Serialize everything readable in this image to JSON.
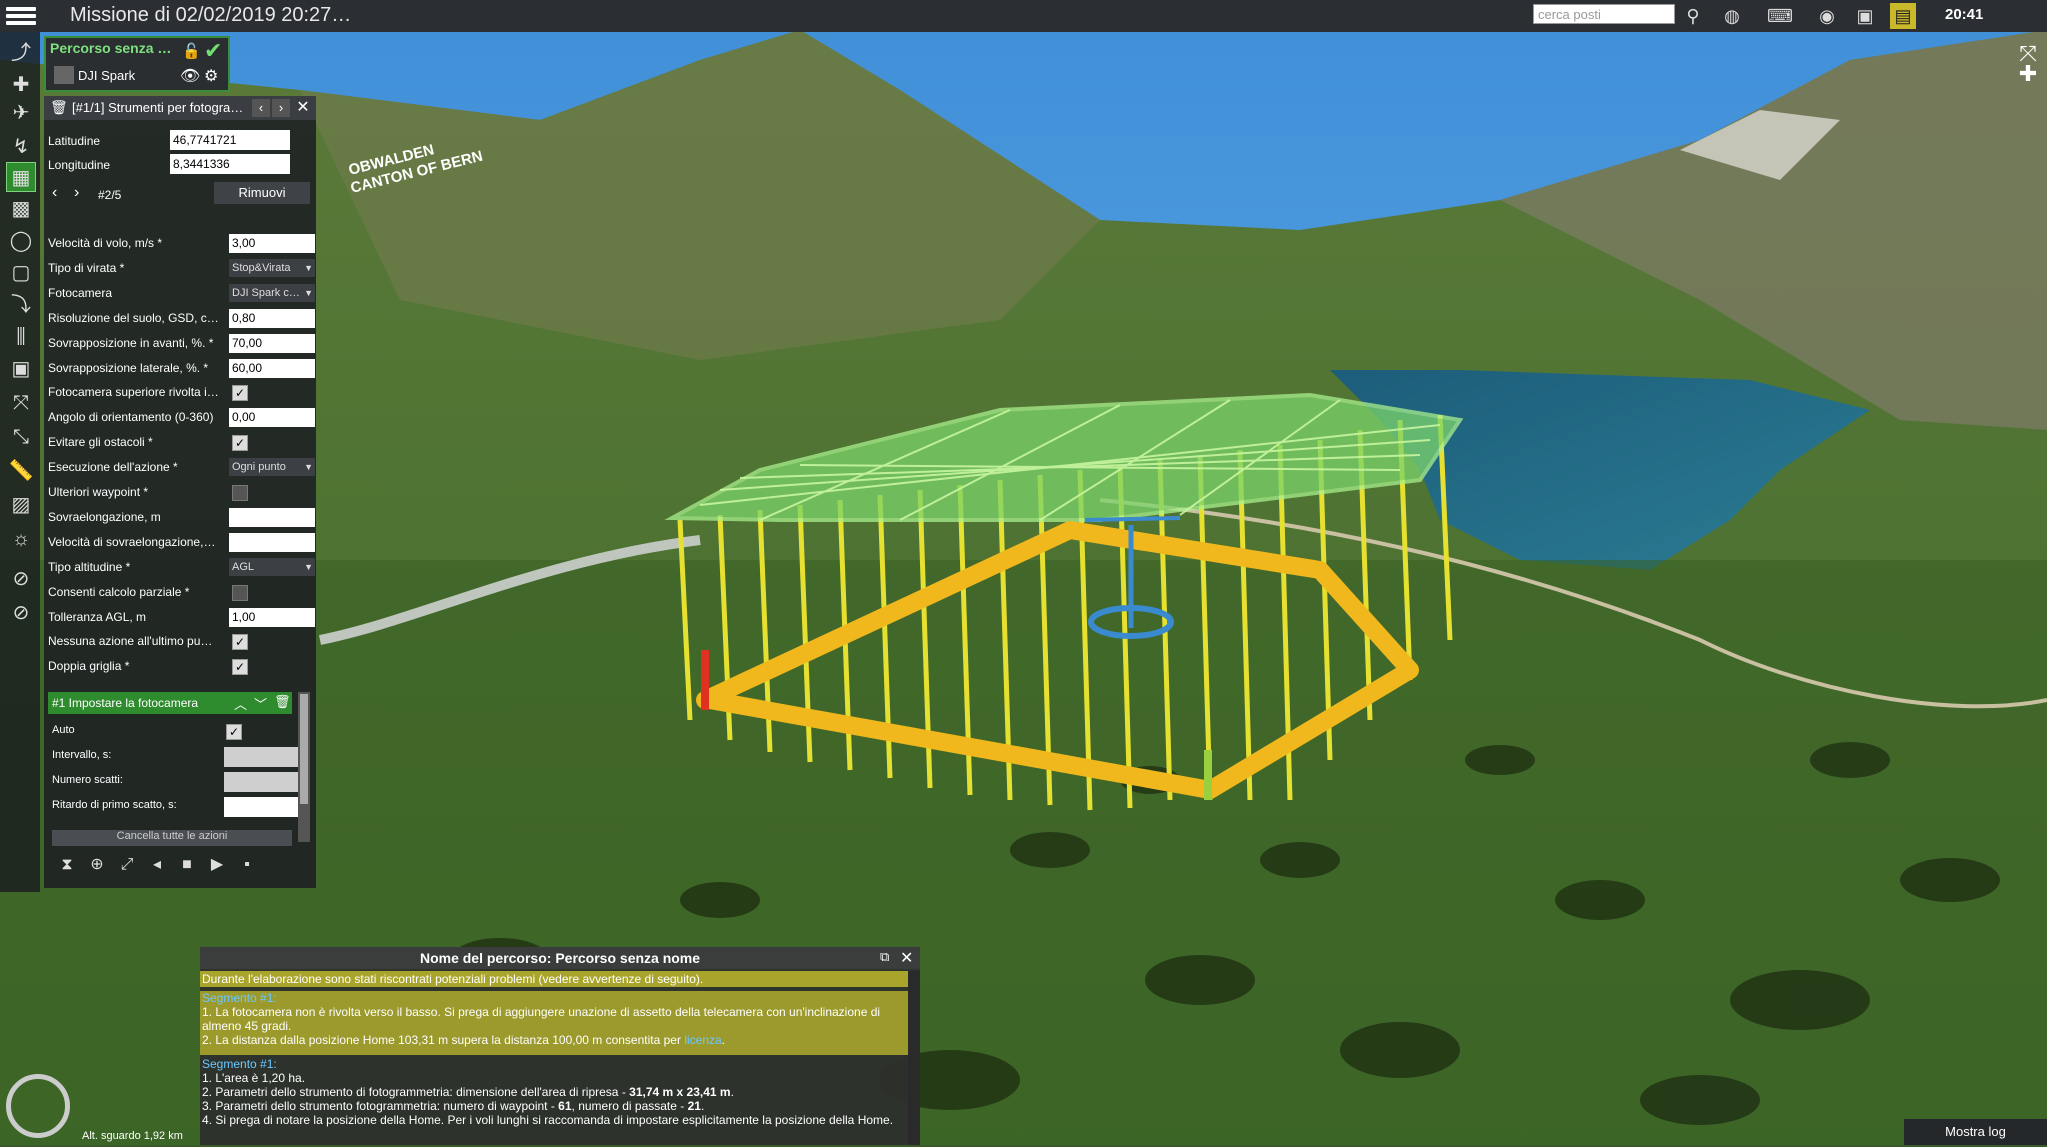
{
  "window": {
    "title": "Missione di 02/02/2019 20:27…",
    "clock": "20:41"
  },
  "search": {
    "placeholder": "cerca posti"
  },
  "route": {
    "name": "Percorso senza …",
    "drone": "DJI Spark"
  },
  "tool_panel": {
    "title": "[#1/1] Strumenti per fotogra…",
    "latitude_label": "Latitudine",
    "latitude_value": "46,7741721",
    "longitude_label": "Longitudine",
    "longitude_value": "8,3441336",
    "point_index": "#2/5",
    "remove_label": "Rimuovi",
    "params": [
      {
        "label": "Velocità di volo, m/s *",
        "type": "field",
        "value": "3,00"
      },
      {
        "label": "Tipo di virata *",
        "type": "select",
        "value": "Stop&Virata"
      },
      {
        "label": "Fotocamera",
        "type": "select",
        "value": "DJI Spark c…"
      },
      {
        "label": "Risoluzione del suolo, GSD, c…",
        "type": "field",
        "value": "0,80"
      },
      {
        "label": "Sovrapposizione in avanti, %. *",
        "type": "field",
        "value": "70,00"
      },
      {
        "label": "Sovrapposizione laterale, %. *",
        "type": "field",
        "value": "60,00"
      },
      {
        "label": "Fotocamera superiore rivolta i…",
        "type": "check",
        "value": "true"
      },
      {
        "label": "Angolo di orientamento (0-360)",
        "type": "field",
        "value": "0,00"
      },
      {
        "label": "Evitare gli ostacoli *",
        "type": "check",
        "value": "true"
      },
      {
        "label": "Esecuzione dell'azione *",
        "type": "select",
        "value": "Ogni punto"
      },
      {
        "label": "Ulteriori waypoint *",
        "type": "check",
        "value": "false"
      },
      {
        "label": "Sovraelongazione, m",
        "type": "field",
        "value": ""
      },
      {
        "label": "Velocità di sovraelongazione,…",
        "type": "field",
        "value": ""
      },
      {
        "label": "Tipo altitudine *",
        "type": "select",
        "value": "AGL"
      },
      {
        "label": "Consenti calcolo parziale *",
        "type": "check",
        "value": "false"
      },
      {
        "label": "Tolleranza AGL, m",
        "type": "field",
        "value": "1,00"
      },
      {
        "label": "Nessuna azione all'ultimo pu…",
        "type": "check",
        "value": "true"
      },
      {
        "label": "Doppia griglia *",
        "type": "check",
        "value": "true"
      }
    ]
  },
  "action": {
    "title": "#1 Impostare la fotocamera",
    "rows": [
      {
        "label": "Auto",
        "type": "check"
      },
      {
        "label": "Intervallo, s:",
        "type": "gray"
      },
      {
        "label": "Numero scatti:",
        "type": "gray"
      },
      {
        "label": "Ritardo di primo scatto, s:",
        "type": "white"
      }
    ],
    "cancel_label": "Cancella tutte le azioni"
  },
  "messages": {
    "title": "Nome del percorso: Percorso senza nome",
    "warning": "Durante l'elaborazione sono stati riscontrati potenziali problemi (vedere avvertenze di seguito).",
    "segment1_title": "Segmento #1:",
    "segment1_line1": "1. La fotocamera non è rivolta verso il basso. Si prega di aggiungere unazione di assetto della telecamera con un'inclinazione di almeno 45 gradi.",
    "segment1_line2": "2. La distanza dalla posizione Home 103,31 m supera la distanza 100,00 m consentita per",
    "segment1_link": "licenza",
    "segment2_title": "Segmento #1:",
    "segment2_line1": "1. L'area è 1,20 ha.",
    "segment2_line2_a": "2. Parametri dello strumento di fotogrammetria: dimensione dell'area di ripresa -",
    "segment2_line2_b": "31,74 m x 23,41 m",
    "segment2_line3_a": "3. Parametri dello strumento fotogrammetria: numero di waypoint -",
    "segment2_line3_b": "61",
    "segment2_line3_c": ", numero di passate -",
    "segment2_line3_d": "21",
    "segment2_line4": "4. Si prega di notare la posizione della Home. Per i voli lunghi si raccomanda di impostare esplicitamente la posizione della Home."
  },
  "status": {
    "view_altitude": "Alt. sguardo 1,92 km",
    "show_log": "Mostra log"
  },
  "map_labels": {
    "region": "OBWALDEN\nCANTON OF BERN"
  }
}
